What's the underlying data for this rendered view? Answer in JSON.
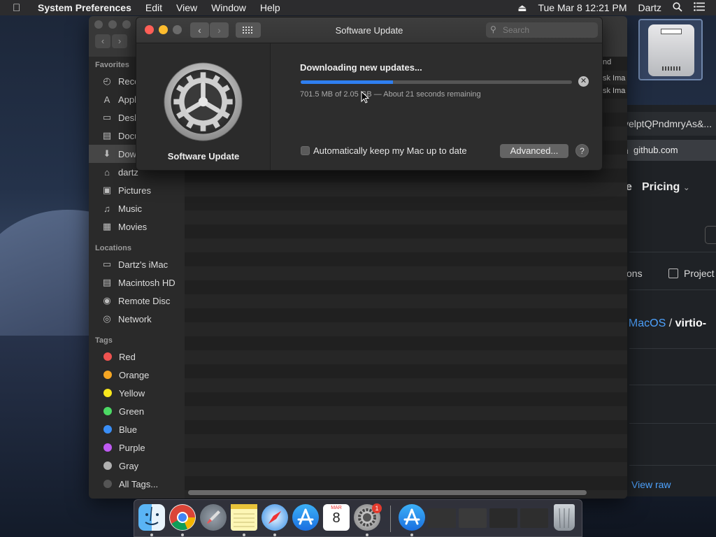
{
  "menubar": {
    "app": "System Preferences",
    "items": [
      "Edit",
      "View",
      "Window",
      "Help"
    ],
    "datetime": "Tue Mar 8  12:21 PM",
    "user": "Dartz"
  },
  "software_update": {
    "title": "Software Update",
    "search_placeholder": "Search",
    "app_label": "Software Update",
    "status": "Downloading new updates...",
    "progress_fraction": 0.34,
    "detail": "701.5 MB of 2.05 GB — About 21 seconds remaining",
    "auto_update_label": "Automatically keep my Mac up to date",
    "advanced_label": "Advanced...",
    "help_label": "?"
  },
  "finder": {
    "sections": {
      "favorites": "Favorites",
      "locations": "Locations",
      "tags": "Tags"
    },
    "favorites": [
      {
        "label": "Recents",
        "icon": "clock-icon"
      },
      {
        "label": "Applications",
        "icon": "applications-icon"
      },
      {
        "label": "Desktop",
        "icon": "desktop-icon"
      },
      {
        "label": "Documents",
        "icon": "document-icon"
      },
      {
        "label": "Downloads",
        "icon": "download-icon"
      },
      {
        "label": "dartz",
        "icon": "home-icon"
      },
      {
        "label": "Pictures",
        "icon": "camera-icon"
      },
      {
        "label": "Music",
        "icon": "music-icon"
      },
      {
        "label": "Movies",
        "icon": "film-icon"
      }
    ],
    "locations": [
      {
        "label": "Dartz's iMac",
        "icon": "imac-icon"
      },
      {
        "label": "Macintosh HD",
        "icon": "harddisk-icon"
      },
      {
        "label": "Remote Disc",
        "icon": "disc-icon"
      },
      {
        "label": "Network",
        "icon": "network-icon"
      }
    ],
    "tags": [
      {
        "label": "Red",
        "color": "#ef5350"
      },
      {
        "label": "Orange",
        "color": "#f5a623"
      },
      {
        "label": "Yellow",
        "color": "#f8e71c"
      },
      {
        "label": "Green",
        "color": "#4cd964"
      },
      {
        "label": "Blue",
        "color": "#3a8ef6"
      },
      {
        "label": "Purple",
        "color": "#bf5af2"
      },
      {
        "label": "Gray",
        "color": "#b0b0b0"
      },
      {
        "label": "All Tags...",
        "color": "#555555"
      }
    ],
    "column_header_fragment": "nd",
    "row_fragments": [
      "sk Ima",
      "sk Ima"
    ]
  },
  "browser": {
    "address_fragment": "velptQPndmryAs&...",
    "domain": "github.com",
    "nav_e": "e",
    "pricing": "Pricing",
    "tab_ons": "ons",
    "tab_projects": "Project",
    "breadcrumb_sep1": "/",
    "breadcrumb_link": "MacOS",
    "breadcrumb_sep2": "/",
    "breadcrumb_bold": "virtio-",
    "view_raw": "View raw"
  },
  "dock": {
    "apps": [
      "Finder",
      "Chrome",
      "Launchpad",
      "Notes",
      "Safari",
      "App Store",
      "Calendar",
      "System Preferences",
      "App Store Downloads",
      "Window 1",
      "Window 2",
      "Window 3",
      "Window 4",
      "Trash"
    ],
    "calendar_month": "MAR",
    "calendar_day": "8",
    "sysprefs_badge": "1"
  },
  "colors": {
    "accent": "#2f7ff0",
    "close": "#ff5f57",
    "minimize": "#febc2e",
    "link": "#4ea3ff"
  }
}
